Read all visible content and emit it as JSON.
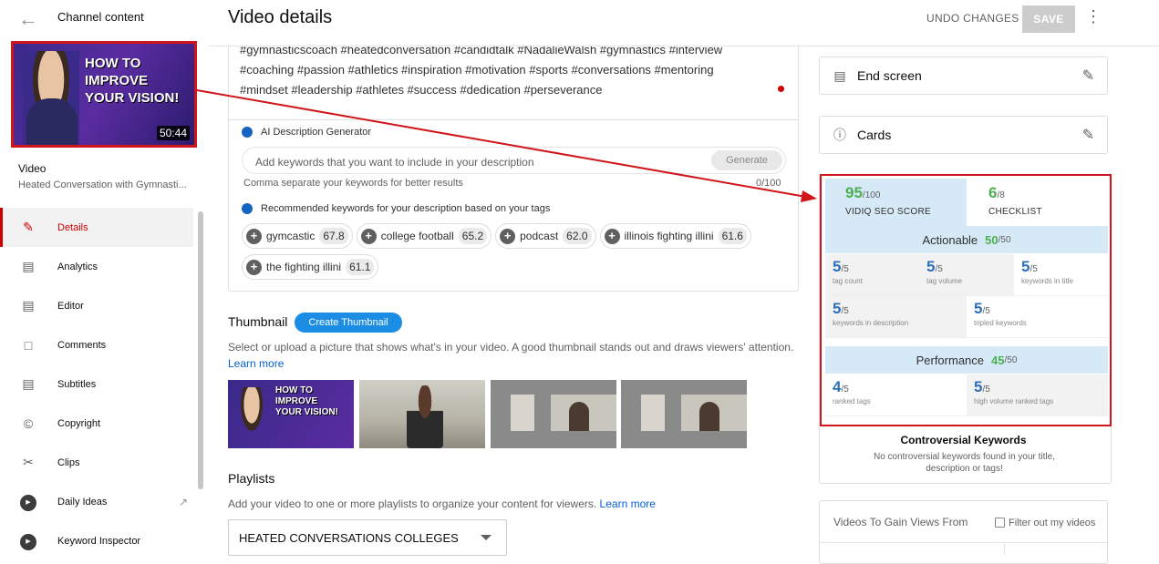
{
  "sidebar": {
    "back_title": "Channel content",
    "thumbnail": {
      "lines": [
        "HOW TO",
        "IMPROVE",
        "YOUR VISION!"
      ],
      "duration": "50:44"
    },
    "video_heading": "Video",
    "video_subtitle": "Heated Conversation with Gymnasti...",
    "items": [
      {
        "label": "Details",
        "icon": "pencil-icon",
        "active": true
      },
      {
        "label": "Analytics",
        "icon": "analytics-icon"
      },
      {
        "label": "Editor",
        "icon": "editor-icon"
      },
      {
        "label": "Comments",
        "icon": "comments-icon"
      },
      {
        "label": "Subtitles",
        "icon": "subtitles-icon"
      },
      {
        "label": "Copyright",
        "icon": "copyright-icon"
      },
      {
        "label": "Clips",
        "icon": "scissors-icon"
      },
      {
        "label": "Daily Ideas",
        "icon": "vidiq-icon",
        "external": true
      },
      {
        "label": "Keyword Inspector",
        "icon": "vidiq-icon"
      }
    ]
  },
  "header": {
    "title": "Video details",
    "undo_label": "UNDO CHANGES",
    "save_label": "SAVE"
  },
  "description": {
    "text_lines": [
      "#gymnasticscoach #heatedconversation #candidtalk #NadalieWalsh #gymnastics #interview",
      "#coaching #passion #athletics #inspiration #motivation #sports #conversations #mentoring",
      "#mindset #leadership #athletes  #success  #dedication  #perseverance"
    ],
    "ai_label": "AI Description Generator",
    "keyword_placeholder": "Add keywords that you want to include in your description",
    "generate_label": "Generate",
    "hint": "Comma separate your keywords for better results",
    "count": "0/100",
    "rec_label": "Recommended keywords for your description based on your tags",
    "keywords": [
      {
        "label": "gymcastic",
        "score": "67.8"
      },
      {
        "label": "college football",
        "score": "65.2"
      },
      {
        "label": "podcast",
        "score": "62.0"
      },
      {
        "label": "illinois fighting illini",
        "score": "61.6"
      },
      {
        "label": "the fighting illini",
        "score": "61.1"
      }
    ]
  },
  "thumbnail_section": {
    "heading": "Thumbnail",
    "create_label": "Create Thumbnail",
    "description": "Select or upload a picture that shows what's in your video. A good thumbnail stands out and draws viewers' attention.",
    "learn_more": "Learn more",
    "tile1_lines": [
      "HOW TO",
      "IMPROVE",
      "YOUR VISION!"
    ]
  },
  "playlists": {
    "heading": "Playlists",
    "description": "Add your video to one or more playlists to organize your content for viewers.",
    "learn_more": "Learn more",
    "selected": "HEATED CONVERSATIONS COLLEGES"
  },
  "right": {
    "end_screen": "End screen",
    "cards": "Cards",
    "seo": {
      "score": "95",
      "score_den": "/100",
      "score_label": "VIDIQ SEO SCORE",
      "checklist": "6",
      "checklist_den": "/8",
      "checklist_label": "CHECKLIST",
      "actionable_label": "Actionable",
      "actionable_score": "50",
      "actionable_den": "/50",
      "actionable_items": [
        {
          "value": "5",
          "den": "/5",
          "label": "tag count"
        },
        {
          "value": "5",
          "den": "/5",
          "label": "tag volume"
        },
        {
          "value": "5",
          "den": "/5",
          "label": "keywords in title"
        },
        {
          "value": "5",
          "den": "/5",
          "label": "keywords in description"
        },
        {
          "value": "5",
          "den": "/5",
          "label": "tripled keywords"
        }
      ],
      "performance_label": "Performance",
      "performance_score": "45",
      "performance_den": "/50",
      "performance_items": [
        {
          "value": "4",
          "den": "/5",
          "label": "ranked tags"
        },
        {
          "value": "5",
          "den": "/5",
          "label": "high volume ranked tags"
        }
      ]
    },
    "controversial_heading": "Controversial Keywords",
    "controversial_text": "No controversial keywords found in your title, description or tags!",
    "videos_title": "Videos To Gain Views From",
    "filter_label": "Filter out my videos"
  },
  "colors": {
    "accent_red": "#d0161b",
    "vidiq_green": "#4caf50",
    "vidiq_blue": "#2e6fba",
    "youtube_blue": "#065fd4"
  }
}
